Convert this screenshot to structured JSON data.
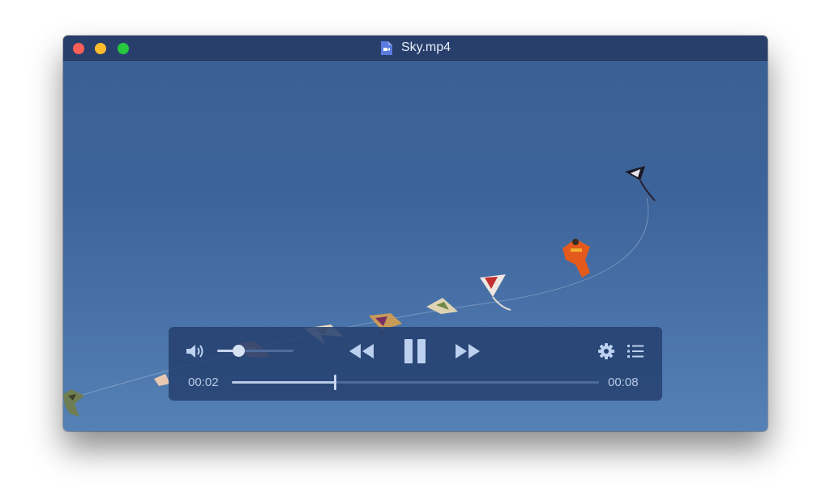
{
  "window": {
    "title": "Sky.mp4"
  },
  "player": {
    "current_time": "00:02",
    "total_time": "00:08",
    "progress": 0.28,
    "volume": 0.28,
    "state": "playing"
  },
  "icons": {
    "file": "video-file-icon",
    "volume": "speaker-icon",
    "rewind": "rewind-icon",
    "pause": "pause-icon",
    "forward": "fast-forward-icon",
    "settings": "gear-icon",
    "playlist": "list-icon"
  },
  "colors": {
    "titlebar": "#283f6c",
    "controls_bg": "#264170",
    "control_icon": "#bcd0ef",
    "sky": "#3d649a"
  }
}
